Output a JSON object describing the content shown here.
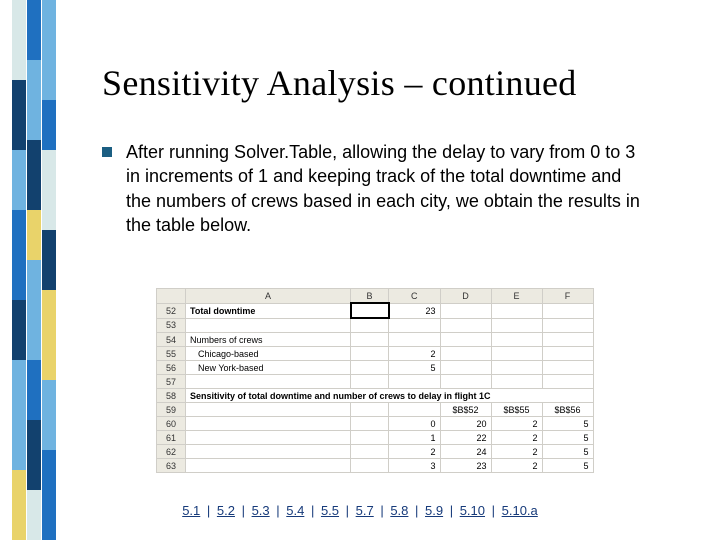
{
  "title": "Sensitivity Analysis – continued",
  "bullet": "After running Solver.Table, allowing the delay to vary from 0 to 3 in increments of 1 and keeping track of the total downtime and the numbers of crews based in each city, we obtain the results in the table below.",
  "sheet": {
    "col_headers": [
      "A",
      "B",
      "C",
      "D",
      "E",
      "F"
    ],
    "rows": [
      {
        "n": "52",
        "a": "Total downtime",
        "a_bold": true,
        "b": "",
        "c": "23",
        "d": "",
        "e": "",
        "f": ""
      },
      {
        "n": "53",
        "a": "",
        "b": "",
        "c": "",
        "d": "",
        "e": "",
        "f": ""
      },
      {
        "n": "54",
        "a": "Numbers of crews",
        "b": "",
        "c": "",
        "d": "",
        "e": "",
        "f": ""
      },
      {
        "n": "55",
        "a": "Chicago-based",
        "indent": true,
        "b": "",
        "c": "2",
        "d": "",
        "e": "",
        "f": ""
      },
      {
        "n": "56",
        "a": "New York-based",
        "indent": true,
        "b": "",
        "c": "5",
        "d": "",
        "e": "",
        "f": ""
      },
      {
        "n": "57",
        "a": "",
        "b": "",
        "c": "",
        "d": "",
        "e": "",
        "f": ""
      },
      {
        "n": "58",
        "a": "Sensitivity of total downtime and number of crews to delay in flight 1C",
        "a_bold": true,
        "b": "",
        "c": "",
        "d": "",
        "e": "",
        "f": ""
      },
      {
        "n": "59",
        "a": "",
        "b": "",
        "c": "",
        "d": "$B$52",
        "e": "$B$55",
        "f": "$B$56"
      },
      {
        "n": "60",
        "a": "",
        "b": "",
        "c": "0",
        "d": "20",
        "e": "2",
        "f": "5"
      },
      {
        "n": "61",
        "a": "",
        "b": "",
        "c": "1",
        "d": "22",
        "e": "2",
        "f": "5"
      },
      {
        "n": "62",
        "a": "",
        "b": "",
        "c": "2",
        "d": "24",
        "e": "2",
        "f": "5"
      },
      {
        "n": "63",
        "a": "",
        "b": "",
        "c": "3",
        "d": "23",
        "e": "2",
        "f": "5"
      }
    ]
  },
  "nav": [
    "5.1",
    "5.2",
    "5.3",
    "5.4",
    "5.5",
    "5.7",
    "5.8",
    "5.9",
    "5.10",
    "5.10.a"
  ],
  "colors": {
    "bullet": "#1b5e82",
    "nav_link": "#163a7a",
    "deco_dark": "#12416e",
    "deco_mid": "#1f70c0",
    "deco_light": "#6fb3e0",
    "deco_pale": "#d8e8e8",
    "deco_yellow": "#e9d36a"
  },
  "chart_data": {
    "type": "table",
    "title": "Sensitivity of total downtime and number of crews to delay in flight 1C",
    "base": {
      "total_downtime": 23,
      "chicago_based_crews": 2,
      "new_york_based_crews": 5
    },
    "columns": [
      "delay_flight_1C",
      "total_downtime ($B$52)",
      "chicago_based_crews ($B$55)",
      "new_york_based_crews ($B$56)"
    ],
    "rows": [
      [
        0,
        20,
        2,
        5
      ],
      [
        1,
        22,
        2,
        5
      ],
      [
        2,
        24,
        2,
        5
      ],
      [
        3,
        23,
        2,
        5
      ]
    ]
  }
}
